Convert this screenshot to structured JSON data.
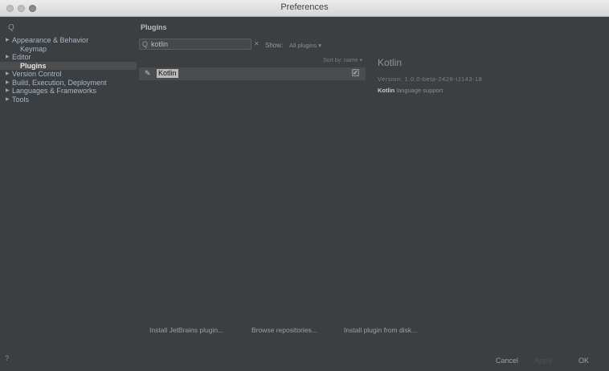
{
  "window": {
    "title": "Preferences"
  },
  "sidebar": {
    "search_icon": "Q",
    "items": [
      {
        "label": "Appearance & Behavior",
        "expandable": true
      },
      {
        "label": "Keymap",
        "expandable": false
      },
      {
        "label": "Editor",
        "expandable": true
      },
      {
        "label": "Plugins",
        "expandable": false,
        "selected": true
      },
      {
        "label": "Version Control",
        "expandable": true
      },
      {
        "label": "Build, Execution, Deployment",
        "expandable": true
      },
      {
        "label": "Languages & Frameworks",
        "expandable": true
      },
      {
        "label": "Tools",
        "expandable": true
      }
    ]
  },
  "main": {
    "title": "Plugins",
    "search": {
      "value": "kotlin",
      "icon": "search-icon"
    },
    "show_label": "Show:",
    "show_value": "All plugins ▾",
    "sort_label": "Sort by: name ▾",
    "plugins": [
      {
        "name": "Kotlin",
        "enabled": true
      }
    ],
    "detail": {
      "name": "Kotlin",
      "version": "Version: 1.0.0-beta-2428-IJ143-18",
      "desc_bold": "Kotlin",
      "desc_rest": " language support"
    },
    "buttons": {
      "install_jetbrains": "Install JetBrains plugin...",
      "browse": "Browse repositories...",
      "install_disk": "Install plugin from disk..."
    }
  },
  "footer": {
    "help": "?",
    "cancel": "Cancel",
    "apply": "Apply",
    "ok": "OK"
  },
  "colors": {
    "background": "#3c3f41",
    "selection": "#4b4d4f",
    "text": "#a9b7c6"
  }
}
